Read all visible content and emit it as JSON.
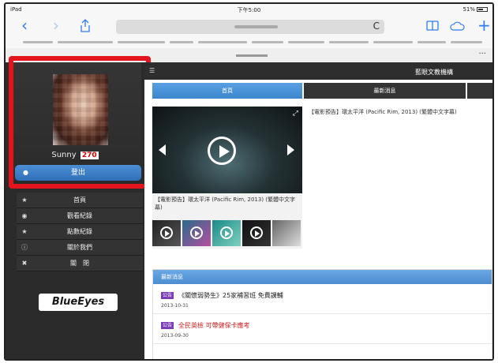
{
  "statusbar": {
    "carrier": "iPad",
    "time": "下午5:00",
    "battery": "51%"
  },
  "browser": {
    "back": "‹",
    "forward": "›",
    "reload": "C"
  },
  "sidebar": {
    "username": "Sunny",
    "count": "270",
    "logout_label": "登出",
    "menu": [
      {
        "label": "首頁",
        "icon": "home-icon"
      },
      {
        "label": "觀看紀錄",
        "icon": "eye-icon"
      },
      {
        "label": "點數紀錄",
        "icon": "star-icon"
      },
      {
        "label": "關於我們",
        "icon": "info-icon"
      },
      {
        "label": "關　閉",
        "icon": "close-icon"
      }
    ],
    "logo": "BlueEyes"
  },
  "main": {
    "app_title": "藍眼文教機構",
    "tabs": [
      {
        "label": "首頁"
      },
      {
        "label": "最新消息"
      }
    ],
    "video_caption": "【電影預告】環太平洋 (Pacific Rim, 2013) (繁體中文字幕)",
    "side_caption": "【電影預告】環太平洋 (Pacific Rim, 2013) (繁體中文字幕)",
    "news": {
      "header": "最新消息",
      "items": [
        {
          "tag": "公告",
          "title": "《關懷弱勢生》25家補習班 免費課輔",
          "date": "2013-10-31"
        },
        {
          "tag": "公告",
          "title": "全民英檢 可帶健保卡應考",
          "date": "2013-09-30"
        }
      ]
    }
  }
}
